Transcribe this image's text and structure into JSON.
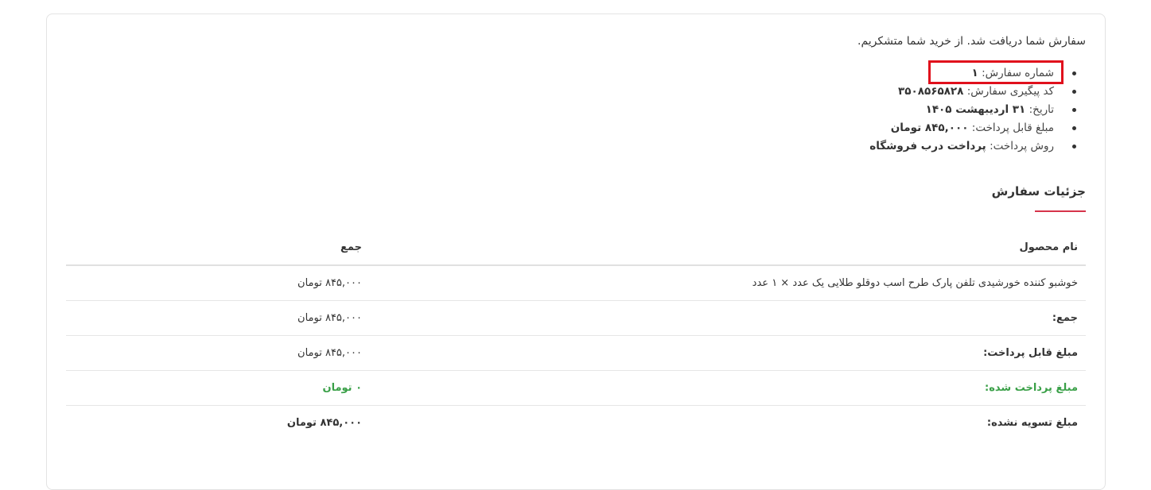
{
  "thanks_message": "سفارش شما دریافت شد. از خرید شما متشکریم.",
  "overview": [
    {
      "label": "شماره سفارش:",
      "value": "۱"
    },
    {
      "label": "کد پیگیری سفارش:",
      "value": "۳۵۰۸۵۶۵۸۲۸"
    },
    {
      "label": "تاریخ:",
      "value": "۳۱ اردیبهشت ۱۴۰۵"
    },
    {
      "label": "مبلغ قابل پرداخت:",
      "value": "۸۴۵,۰۰۰ تومان"
    },
    {
      "label": "روش پرداخت:",
      "value": "پرداخت درب فروشگاه"
    }
  ],
  "details_title": "جزئیات سفارش",
  "table": {
    "headers": {
      "product": "نام محصول",
      "total": "جمع"
    },
    "item": {
      "product": "خوشبو کننده خورشیدی تلفن پارک طرح اسب دوقلو طلایی یک عدد × ۱ عدد",
      "total": "۸۴۵,۰۰۰ تومان"
    },
    "totals": [
      {
        "label": "جمع:",
        "value": "۸۴۵,۰۰۰ تومان"
      },
      {
        "label": "مبلغ قابل پرداخت:",
        "value": "۸۴۵,۰۰۰ تومان"
      },
      {
        "label": "مبلغ پرداخت شده:",
        "value": "۰ تومان"
      },
      {
        "label": "مبلغ تسویه نشده:",
        "value": "۸۴۵,۰۰۰ تومان"
      }
    ]
  },
  "colors": {
    "highlight": "#e0101c",
    "accent": "#d6334a",
    "paid": "#3aa048"
  }
}
